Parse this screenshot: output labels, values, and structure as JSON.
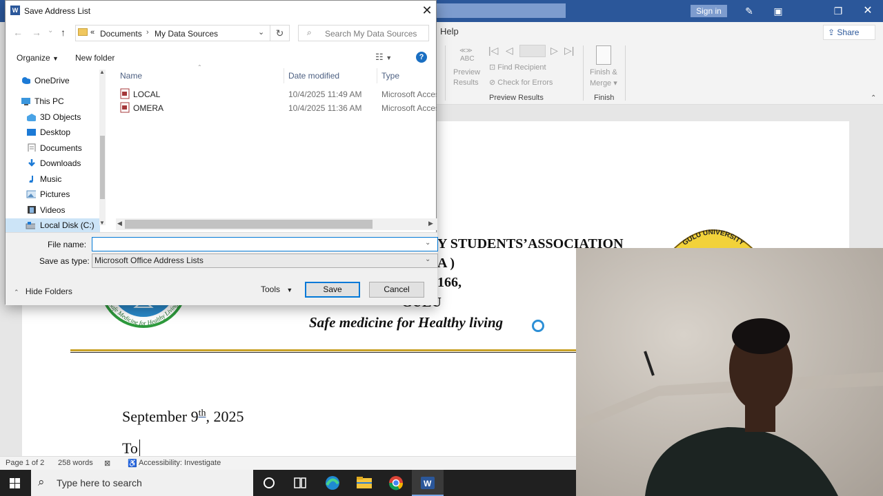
{
  "word": {
    "signin_label": "Sign in",
    "share_label": "Share",
    "help_tab": "Help",
    "ribbon": {
      "preview_results_btn": "Preview\nResults",
      "preview_line1": "Preview",
      "preview_line2": "Results",
      "abc": "ABC",
      "find_recipient": "Find Recipient",
      "check_for_errors": "Check for Errors",
      "preview_results_group": "Preview Results",
      "finish_line1": "Finish &",
      "finish_line2": "Merge",
      "finish_group": "Finish"
    },
    "document": {
      "heading_line1": "Y STUDENTS’ASSOCIATION",
      "heading_line2": "A  )",
      "heading_line3": "166,",
      "heading_line4": "GULU",
      "tagline": "Safe medicine for Healthy living",
      "date_prefix": "September 9",
      "date_sup": "th",
      "date_suffix": ", 2025",
      "to_line": "To ",
      "left_logo_text": "Safe Medicine for Healthy Living",
      "right_logo_text": "GULU UNIVERSITY"
    },
    "status": {
      "page": "Page 1 of 2",
      "words": "258 words",
      "accessibility": "Accessibility: Investigate"
    }
  },
  "taskbar": {
    "search_placeholder": "Type here to search"
  },
  "dialog": {
    "title": "Save Address List",
    "breadcrumb": {
      "prefix": "«",
      "parts": [
        "Documents",
        "My Data Sources"
      ]
    },
    "search_placeholder": "Search My Data Sources",
    "toolbar": {
      "organize": "Organize",
      "new_folder": "New folder"
    },
    "nav": [
      {
        "label": "OneDrive",
        "icon": "cloud-icon"
      },
      {
        "label": "This PC",
        "icon": "computer-icon"
      },
      {
        "label": "3D Objects",
        "icon": "cube-icon"
      },
      {
        "label": "Desktop",
        "icon": "desktop-icon"
      },
      {
        "label": "Documents",
        "icon": "document-icon"
      },
      {
        "label": "Downloads",
        "icon": "download-icon"
      },
      {
        "label": "Music",
        "icon": "music-icon"
      },
      {
        "label": "Pictures",
        "icon": "pictures-icon"
      },
      {
        "label": "Videos",
        "icon": "video-icon"
      },
      {
        "label": "Local Disk (C:)",
        "icon": "drive-icon"
      }
    ],
    "columns": {
      "name": "Name",
      "date": "Date modified",
      "type": "Type"
    },
    "files": [
      {
        "name": "LOCAL",
        "date": "10/4/2025 11:49 AM",
        "type": "Microsoft Access"
      },
      {
        "name": "OMERA",
        "date": "10/4/2025 11:36 AM",
        "type": "Microsoft Access"
      }
    ],
    "file_name_label": "File name:",
    "file_name_value": "",
    "save_as_type_label": "Save as type:",
    "save_as_type_value": "Microsoft Office Address Lists",
    "hide_folders": "Hide Folders",
    "tools": "Tools",
    "save": "Save",
    "cancel": "Cancel"
  }
}
